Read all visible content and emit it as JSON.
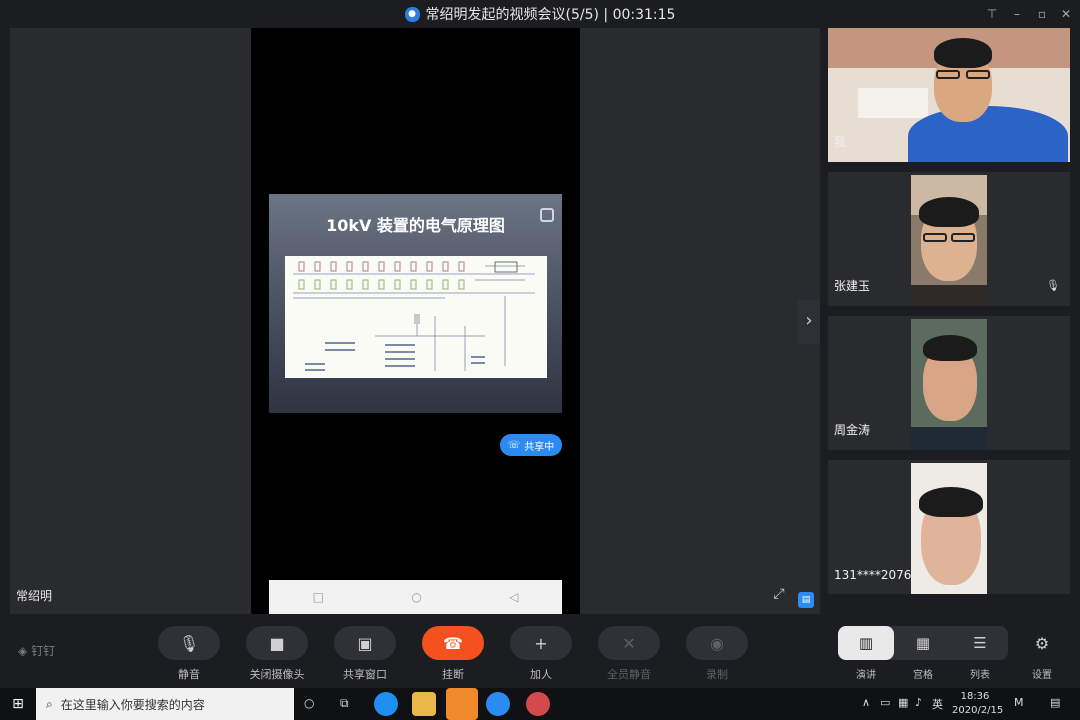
{
  "window": {
    "title": "常绍明发起的视频会议(5/5) | 00:31:15",
    "pin_icon": "pin-icon",
    "min_icon": "minimize-icon",
    "max_icon": "maximize-icon",
    "close_icon": "close-icon"
  },
  "stage": {
    "presenter_name": "常绍明",
    "slide_title": "10kV 装置的电气原理图",
    "share_badge": "共享中",
    "next_icon": "›",
    "fullscreen_icon": "⤢"
  },
  "participants": [
    {
      "name": "我"
    },
    {
      "name": "张建玉",
      "muted": true
    },
    {
      "name": "周金涛"
    },
    {
      "name": "131****2076"
    }
  ],
  "toolbar": {
    "brand": "钉钉",
    "buttons": [
      {
        "label": "静音",
        "icon": "microphone-icon",
        "glyph": "🎙",
        "enabled": true
      },
      {
        "label": "关闭摄像头",
        "icon": "camera-icon",
        "glyph": "■",
        "enabled": true
      },
      {
        "label": "共享窗口",
        "icon": "share-window-icon",
        "glyph": "▣",
        "enabled": true
      },
      {
        "label": "挂断",
        "icon": "hangup-icon",
        "glyph": "☎",
        "enabled": true
      },
      {
        "label": "加人",
        "icon": "add-person-icon",
        "glyph": "+",
        "enabled": true
      },
      {
        "label": "全员静音",
        "icon": "mute-all-icon",
        "glyph": "✕",
        "enabled": false
      },
      {
        "label": "录制",
        "icon": "record-icon",
        "glyph": "◉",
        "enabled": false
      }
    ],
    "views": [
      {
        "label": "演讲",
        "icon": "speaker-view-icon",
        "glyph": "▥",
        "active": true
      },
      {
        "label": "宫格",
        "icon": "grid-view-icon",
        "glyph": "▦",
        "active": false
      },
      {
        "label": "列表",
        "icon": "list-view-icon",
        "glyph": "☰",
        "active": false
      }
    ],
    "settings_label": "设置",
    "settings_glyph": "⚙"
  },
  "taskbar": {
    "search_placeholder": "在这里输入你要搜索的内容",
    "ime": "英",
    "time": "18:36",
    "date": "2020/2/15"
  },
  "colors": {
    "accent": "#2c8bf0",
    "hangup": "#f4511e",
    "background": "#1c1d21"
  }
}
